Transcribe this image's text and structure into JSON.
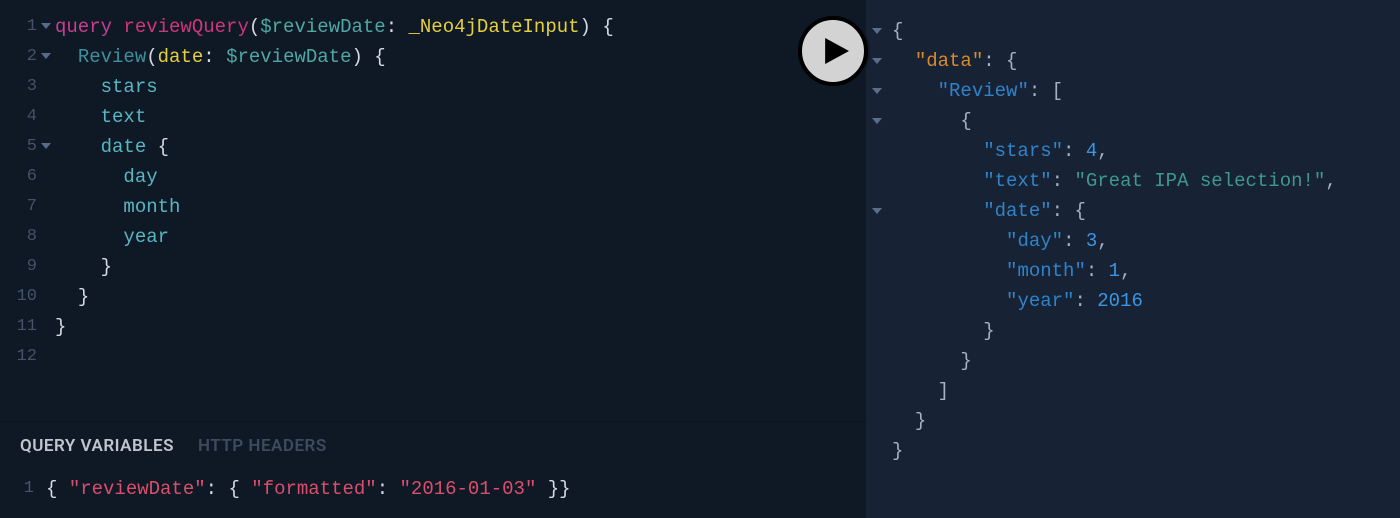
{
  "editor": {
    "line_numbers": [
      "1",
      "2",
      "3",
      "4",
      "5",
      "6",
      "7",
      "8",
      "9",
      "10",
      "11",
      "12"
    ],
    "fold_lines": [
      1,
      2,
      5
    ],
    "l1_keyword": "query",
    "l1_name": "reviewQuery",
    "l1_dollar": "$",
    "l1_var": "reviewDate",
    "l1_type": "_Neo4jDateInput",
    "l2_field": "Review",
    "l2_arg": "date",
    "l2_dollar": "$",
    "l2_var": "reviewDate",
    "l3": "stars",
    "l4": "text",
    "l5": "date",
    "l6": "day",
    "l7": "month",
    "l8": "year"
  },
  "tabs": {
    "variables": "QUERY VARIABLES",
    "headers": "HTTP HEADERS"
  },
  "vars": {
    "line": "1",
    "key1": "reviewDate",
    "key2": "formatted",
    "val": "2016-01-03"
  },
  "result": {
    "k_data": "data",
    "k_review": "Review",
    "k_stars": "stars",
    "v_stars": "4",
    "k_text": "text",
    "v_text": "Great IPA selection!",
    "k_date": "date",
    "k_day": "day",
    "v_day": "3",
    "k_month": "month",
    "v_month": "1",
    "k_year": "year",
    "v_year": "2016"
  }
}
